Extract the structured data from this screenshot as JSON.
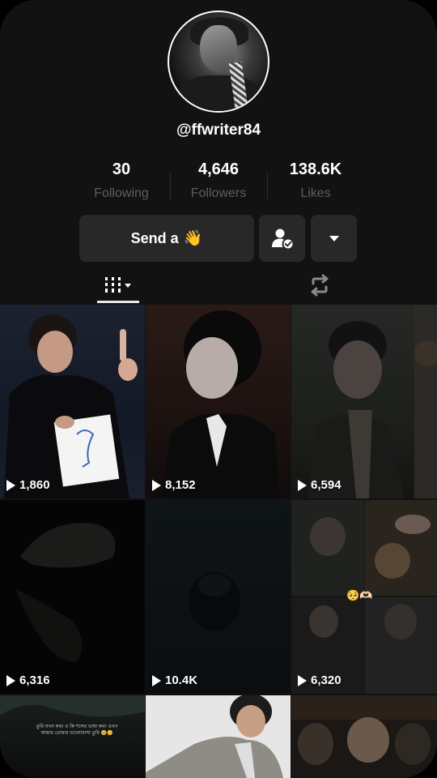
{
  "profile": {
    "username": "@ffwriter84",
    "stats": [
      {
        "value": "30",
        "label": "Following"
      },
      {
        "value": "4,646",
        "label": "Followers"
      },
      {
        "value": "138.6K",
        "label": "Likes"
      }
    ]
  },
  "actions": {
    "send_label": "Send a",
    "send_emoji": "👋"
  },
  "tabs": {
    "videos_icon": "grid-bars-icon",
    "reposts_icon": "repost-icon"
  },
  "videos": [
    {
      "views": "1,860"
    },
    {
      "views": "8,152"
    },
    {
      "views": "6,594"
    },
    {
      "views": "6,316"
    },
    {
      "views": "10.4K"
    },
    {
      "views": "6,320"
    },
    {
      "caption": "তুমি যখন কথা ও কি শব্দের ভাষা কথা এখন আমার তোমার ভালোবাসা তুমি 🥺🙂"
    },
    {},
    {}
  ],
  "cell6_emoji": "🥺🫶🏻"
}
